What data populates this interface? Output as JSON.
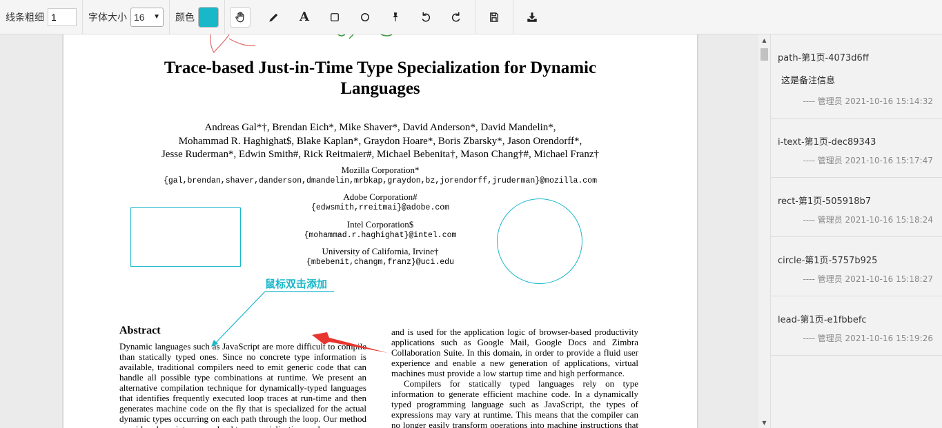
{
  "toolbar": {
    "line_width_label": "线条粗细",
    "line_width_value": "1",
    "font_size_label": "字体大小",
    "font_size_value": "16",
    "color_label": "颜色",
    "color_value": "#19b8c9",
    "tools": [
      {
        "name": "hand-icon",
        "active": true
      },
      {
        "name": "pencil-icon"
      },
      {
        "name": "text-icon",
        "glyph": "A"
      },
      {
        "name": "rectangle-icon"
      },
      {
        "name": "circle-icon"
      },
      {
        "name": "pin-icon"
      },
      {
        "name": "undo-icon"
      },
      {
        "name": "redo-icon"
      },
      {
        "name": "save-icon"
      },
      {
        "name": "download-icon"
      }
    ]
  },
  "document": {
    "title_line1": "Trace-based Just-in-Time Type Specialization for Dynamic",
    "title_line2": "Languages",
    "authors": [
      "Andreas Gal*†, Brendan Eich*, Mike Shaver*, David Anderson*, David Mandelin*,",
      "Mohammad R. Haghighat$, Blake Kaplan*, Graydon Hoare*, Boris Zbarsky*, Jason Orendorff*,",
      "Jesse Ruderman*, Edwin Smith#, Rick Reitmaier#, Michael Bebenita†, Mason Chang†#, Michael Franz†"
    ],
    "affiliations": [
      {
        "name": "Mozilla Corporation*",
        "email": "{gal,brendan,shaver,danderson,dmandelin,mrbkap,graydon,bz,jorendorff,jruderman}@mozilla.com"
      },
      {
        "name": "Adobe Corporation#",
        "email": "{edwsmith,rreitmai}@adobe.com"
      },
      {
        "name": "Intel Corporation$",
        "email": "{mohammad.r.haghighat}@intel.com"
      },
      {
        "name": "University of California, Irvine†",
        "email": "{mbebenit,changm,franz}@uci.edu"
      }
    ],
    "abstract_heading": "Abstract",
    "abstract_text": "Dynamic languages such as JavaScript are more difficult to compile than statically typed ones. Since no concrete type information is available, traditional compilers need to emit generic code that can handle all possible type combinations at runtime. We present an alternative compilation technique for dynamically-typed languages that identifies frequently executed loop traces at run-time and then generates machine code on the fly that is specialized for the actual dynamic types occurring on each path through the loop. Our method provides cheap inter-procedural type specialization, and an",
    "right_col_p1": "and is used for the application logic of browser-based productivity applications such as Google Mail, Google Docs and Zimbra Collaboration Suite. In this domain, in order to provide a fluid user experience and enable a new generation of applications, virtual machines must provide a low startup time and high performance.",
    "right_col_p2": "Compilers for statically typed languages rely on type information to generate efficient machine code. In a dynamically typed programming language such as JavaScript, the types of expressions may vary at runtime. This means that the compiler can no longer easily transform operations into machine instructions that operate"
  },
  "annotations": {
    "lead_label": "鼠标双击添加",
    "stroke_color": "#19b8c9",
    "arrow_color": "#e8352f"
  },
  "notes": [
    {
      "title": "path-第1页-4073d6ff",
      "content": "这是备注信息",
      "meta": "---- 管理员 2021-10-16 15:14:32"
    },
    {
      "title": "i-text-第1页-dec89343",
      "content": "",
      "meta": "---- 管理员 2021-10-16 15:17:47"
    },
    {
      "title": "rect-第1页-505918b7",
      "content": "",
      "meta": "---- 管理员 2021-10-16 15:18:24"
    },
    {
      "title": "circle-第1页-5757b925",
      "content": "",
      "meta": "---- 管理员 2021-10-16 15:18:27"
    },
    {
      "title": "lead-第1页-e1fbbefc",
      "content": "",
      "meta": "---- 管理员 2021-10-16 15:19:26"
    }
  ]
}
